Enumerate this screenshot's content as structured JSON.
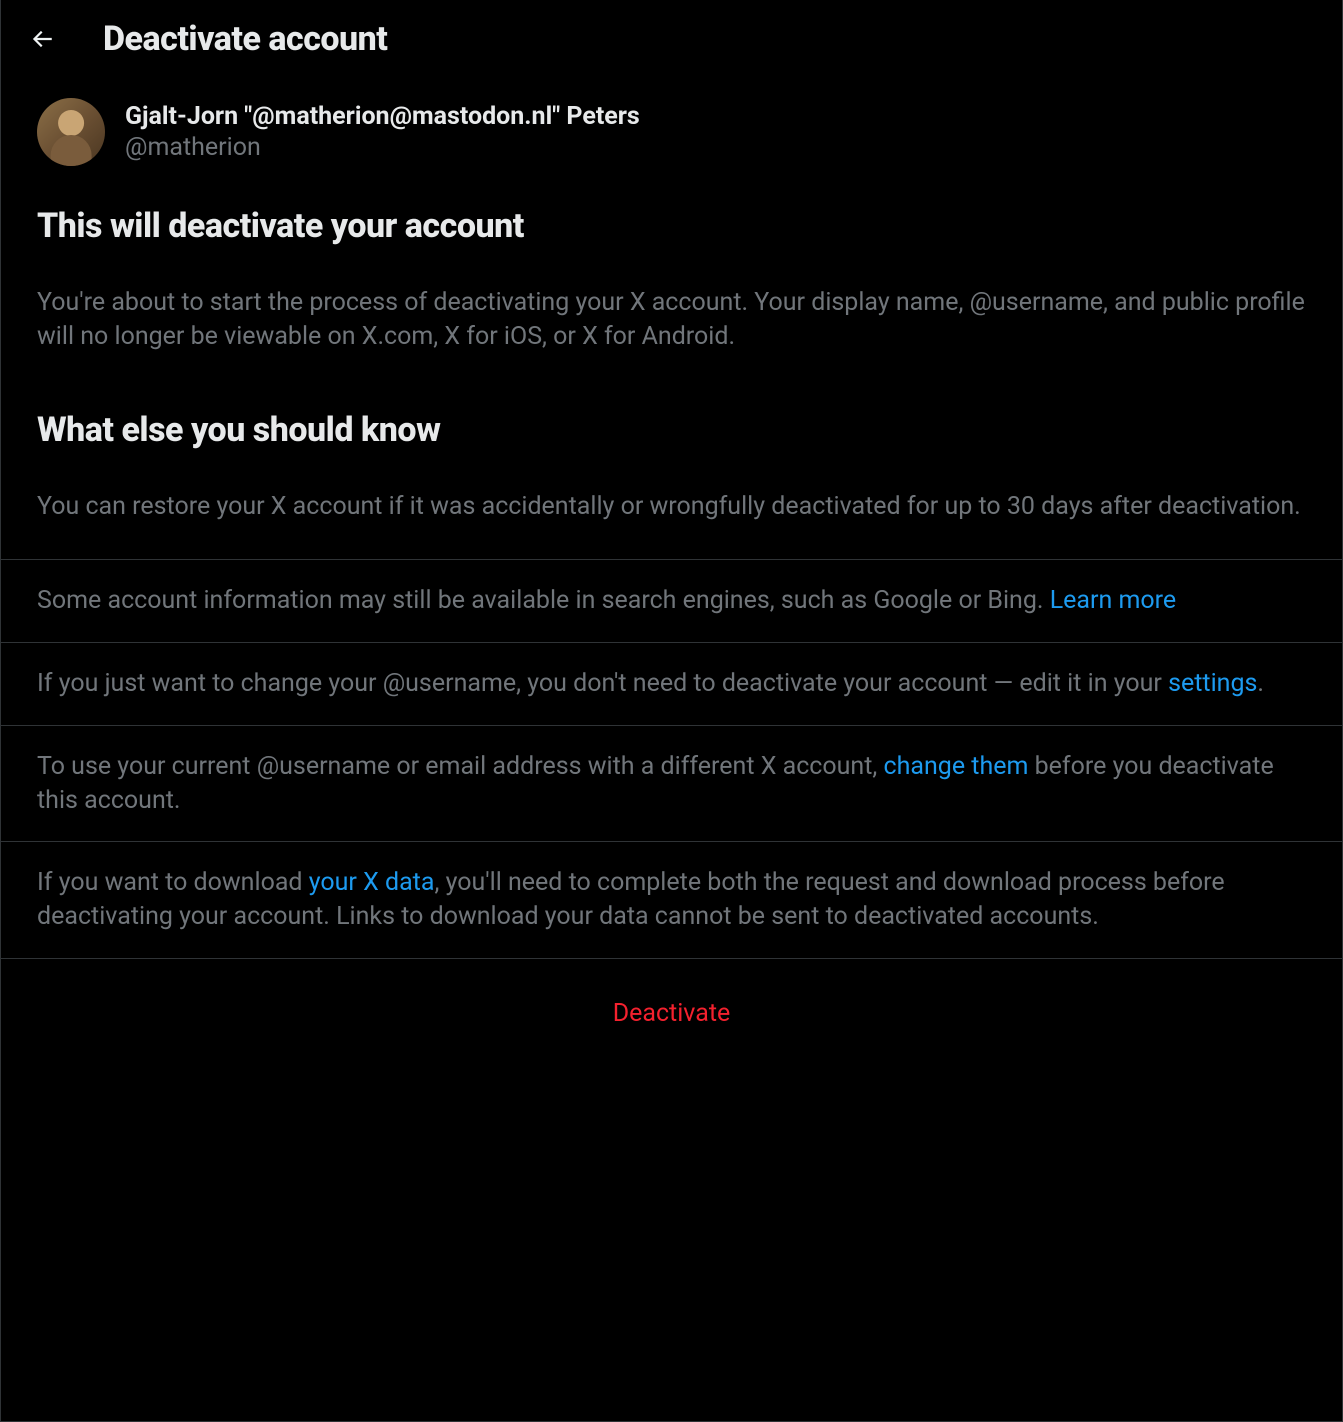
{
  "header": {
    "title": "Deactivate account"
  },
  "user": {
    "display_name": "Gjalt-Jorn \"@matherion@mastodon.nl\" Peters",
    "username": "@matherion"
  },
  "section1": {
    "heading": "This will deactivate your account",
    "text": "You're about to start the process of deactivating your X account. Your display name, @username, and public profile will no longer be viewable on X.com, X for iOS, or X for Android."
  },
  "section2": {
    "heading": "What else you should know",
    "text": "You can restore your X account if it was accidentally or wrongfully deactivated for up to 30 days after deactivation."
  },
  "info_rows": {
    "row1": {
      "text": "Some account information may still be available in search engines, such as Google or Bing. ",
      "link_text": "Learn more"
    },
    "row2": {
      "text_before": "If you just want to change your @username, you don't need to deactivate your account — edit it in your ",
      "link_text": "settings",
      "text_after": "."
    },
    "row3": {
      "text_before": "To use your current @username or email address with a different X account, ",
      "link_text": "change them",
      "text_after": " before you deactivate this account."
    },
    "row4": {
      "text_before": "If you want to download ",
      "link_text": "your X data",
      "text_after": ", you'll need to complete both the request and download process before deactivating your account. Links to download your data cannot be sent to deactivated accounts."
    }
  },
  "deactivate_button": "Deactivate"
}
